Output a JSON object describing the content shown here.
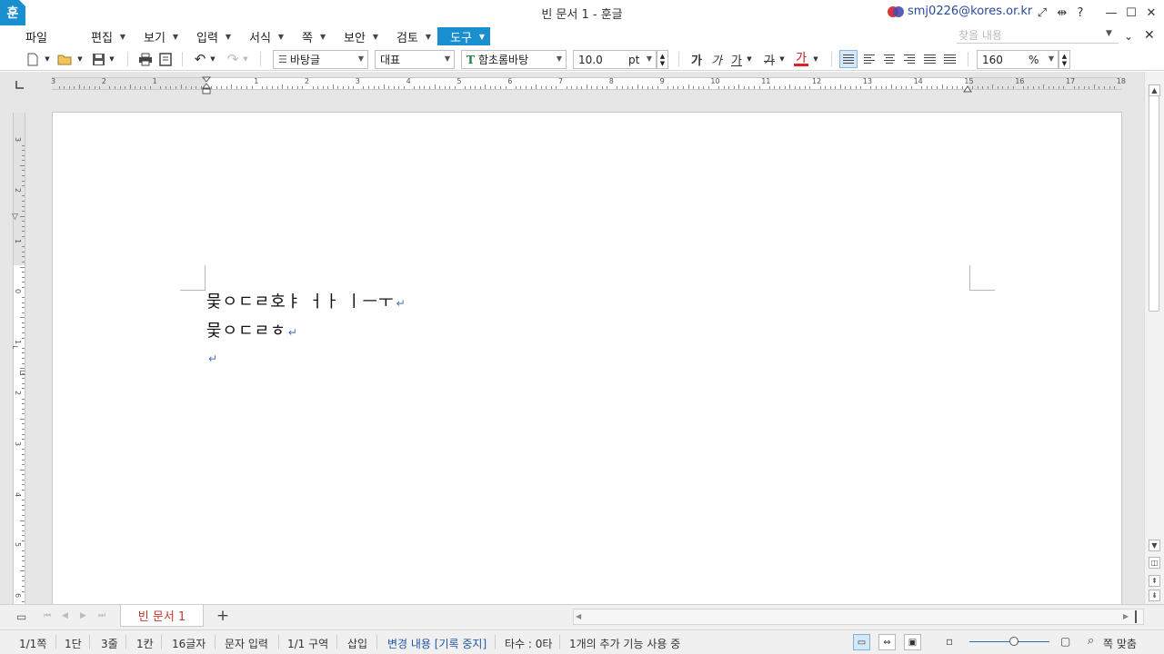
{
  "window": {
    "app_logo": "훈",
    "title": "빈 문서 1 - 훈글",
    "user_email": "smj0226@kores.or.kr",
    "help_label": "?"
  },
  "menu": {
    "items": [
      {
        "label": "파일",
        "has_arrow": false
      },
      {
        "label": "편집",
        "has_arrow": true
      },
      {
        "label": "보기",
        "has_arrow": true
      },
      {
        "label": "입력",
        "has_arrow": true
      },
      {
        "label": "서식",
        "has_arrow": true
      },
      {
        "label": "쪽",
        "has_arrow": true
      },
      {
        "label": "보안",
        "has_arrow": true
      },
      {
        "label": "검토",
        "has_arrow": true
      },
      {
        "label": "도구",
        "has_arrow": true,
        "active": true
      }
    ],
    "find_placeholder": "찾을 내용"
  },
  "toolbar": {
    "style_name": "바탕글",
    "language": "대표",
    "font_name": "함초롬바탕",
    "font_glyph": "T",
    "font_size": "10.0",
    "font_unit": "pt",
    "bold": "가",
    "italic": "가",
    "underline": "가",
    "strike": "가",
    "font_color": "가",
    "zoom_value": "160",
    "zoom_unit": "%"
  },
  "ruler": {
    "h_labels": [
      "3",
      "2",
      "1",
      "",
      "1",
      "2",
      "3",
      "4",
      "5",
      "6",
      "7",
      "8",
      "9",
      "10",
      "11",
      "12",
      "13",
      "14",
      "15",
      "16",
      "17",
      "18"
    ],
    "v_labels": [
      "3",
      "2",
      "1",
      "0",
      "1",
      "2",
      "3",
      "4",
      "5",
      "6"
    ]
  },
  "document": {
    "lines": [
      "뭋ㅇㄷㄹ호ㅑ ㅓㅏ ㅣㅡㅜ",
      "뭋ㅇㄷㄹㅎ",
      ""
    ],
    "paragraph_mark": "↵"
  },
  "tabs": {
    "doc_tab": "빈 문서 1",
    "add": "+"
  },
  "status": {
    "page": "1/1쪽",
    "column": "1단",
    "line": "3줄",
    "col_pos": "1칸",
    "chars": "16글자",
    "input_mode": "문자 입력",
    "section": "1/1 구역",
    "insert_mode": "삽입",
    "track_changes": "변경 내용 [기록 중지]",
    "typing_count": "타수 : 0타",
    "addons": "1개의 추가 기능 사용 중",
    "fit_page": "쪽 맞춤"
  },
  "colors": {
    "accent": "#1a8fd0",
    "tab_text": "#c0392b",
    "status_blue": "#2456a6"
  }
}
